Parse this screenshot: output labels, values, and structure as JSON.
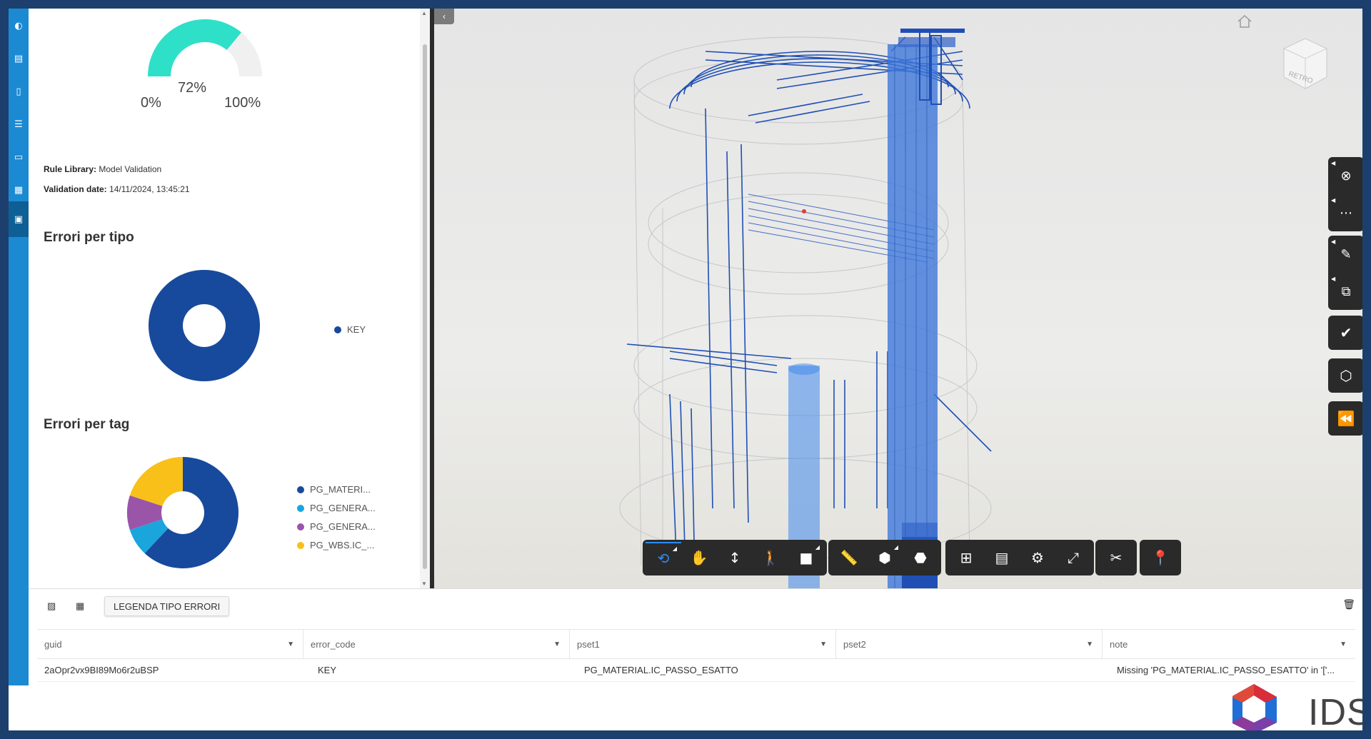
{
  "rail": {
    "items": [
      {
        "icon": "overview-icon"
      },
      {
        "icon": "table-icon"
      },
      {
        "icon": "document-icon"
      },
      {
        "icon": "list-icon"
      },
      {
        "icon": "comment-icon"
      },
      {
        "icon": "grid-icon"
      },
      {
        "icon": "report-icon",
        "active": true
      }
    ]
  },
  "gauge": {
    "value_label": "72%",
    "value": 0.72,
    "min_label": "0%",
    "max_label": "100%",
    "fill_color": "#2ee0c8",
    "track_color": "#f0f0f0"
  },
  "meta": {
    "rule_library_label": "Rule Library:",
    "rule_library_value": "Model Validation",
    "validation_date_label": "Validation date:",
    "validation_date_value": "14/11/2024, 13:45:21"
  },
  "errors_by_type": {
    "title": "Errori per tipo",
    "chart_data": {
      "type": "pie",
      "categories": [
        "KEY"
      ],
      "values": [
        1
      ],
      "colors": [
        "#174a9c"
      ]
    }
  },
  "errors_by_tag": {
    "title": "Errori per tag",
    "chart_data": {
      "type": "pie",
      "categories": [
        "PG_MATERI...",
        "PG_GENERA...",
        "PG_GENERA...",
        "PG_WBS.IC_..."
      ],
      "values": [
        62,
        8,
        10,
        20
      ],
      "colors": [
        "#174a9c",
        "#1aa5dd",
        "#9a55a9",
        "#f8c019"
      ]
    }
  },
  "viewer": {
    "collapse_icon": "chevron-left-icon",
    "home_icon": "home-icon",
    "viewcube_label": "RETRO",
    "side_tools": [
      "section-icon",
      "more-icon",
      "markup-icon",
      "fit-icon",
      "check-icon",
      "model-icon",
      "rewind-icon"
    ],
    "toolbar": [
      "orbit-icon",
      "pan-icon",
      "zoom-icon",
      "walk-icon",
      "camera-icon",
      "measure-icon",
      "explode-icon",
      "cube-icon",
      "structure-icon",
      "properties-icon",
      "settings-icon",
      "fullscreen-icon",
      "tools-icon",
      "pin-icon"
    ]
  },
  "table": {
    "toolbar": {
      "excel_icon": "excel-icon",
      "grid_icon": "grid-icon",
      "legend_button": "LEGENDA TIPO ERRORI",
      "trash_icon": "trash-icon"
    },
    "columns": [
      "guid",
      "error_code",
      "pset1",
      "pset2",
      "note"
    ],
    "rows": [
      [
        "2aOpr2vx9BI89Mo6r2uBSP",
        "KEY",
        "PG_MATERIAL.IC_PASSO_ESATTO",
        "",
        "Missing 'PG_MATERIAL.IC_PASSO_ESATTO' in '['..."
      ]
    ]
  },
  "logo": {
    "text": "IDS"
  }
}
